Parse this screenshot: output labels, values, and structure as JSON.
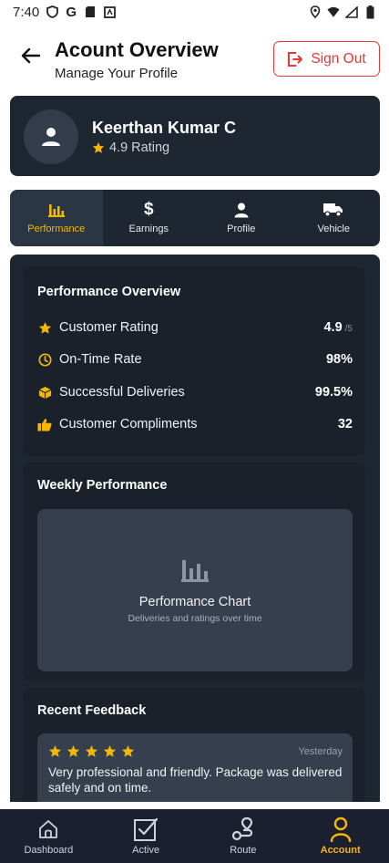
{
  "status_bar": {
    "time": "7:40"
  },
  "header": {
    "title": "Acount Overview",
    "subtitle": "Manage Your Profile",
    "signout_label": "Sign Out"
  },
  "profile": {
    "name": "Keerthan Kumar C",
    "rating": "4.9 Rating"
  },
  "tabs": [
    {
      "label": "Performance",
      "icon": "bar-chart-icon",
      "active": true
    },
    {
      "label": "Earnings",
      "icon": "dollar-icon",
      "active": false
    },
    {
      "label": "Profile",
      "icon": "person-icon",
      "active": false
    },
    {
      "label": "Vehicle",
      "icon": "truck-icon",
      "active": false
    }
  ],
  "performance": {
    "title": "Performance Overview",
    "metrics": [
      {
        "label": "Customer Rating",
        "value": "4.9",
        "unit": "/5",
        "icon": "star-icon"
      },
      {
        "label": "On-Time Rate",
        "value": "98%",
        "unit": "",
        "icon": "clock-icon"
      },
      {
        "label": "Successful Deliveries",
        "value": "99.5%",
        "unit": "",
        "icon": "package-icon"
      },
      {
        "label": "Customer Compliments",
        "value": "32",
        "unit": "",
        "icon": "thumbs-up-icon"
      }
    ]
  },
  "weekly": {
    "title": "Weekly Performance",
    "chart_title": "Performance Chart",
    "chart_subtitle": "Deliveries and ratings over time"
  },
  "feedback": {
    "title": "Recent Feedback",
    "items": [
      {
        "stars": 5,
        "date": "Yesterday",
        "text": "Very professional and friendly. Package was delivered safely and on time."
      }
    ]
  },
  "bottom_nav": [
    {
      "label": "Dashboard",
      "icon": "home-icon",
      "active": false
    },
    {
      "label": "Active",
      "icon": "checkbox-icon",
      "active": false
    },
    {
      "label": "Route",
      "icon": "route-icon",
      "active": false
    },
    {
      "label": "Account",
      "icon": "account-icon",
      "active": true
    }
  ],
  "colors": {
    "accent": "#f5b800",
    "danger": "#e53935",
    "card_bg": "#1e2631",
    "nav_bg": "#1a2030"
  }
}
